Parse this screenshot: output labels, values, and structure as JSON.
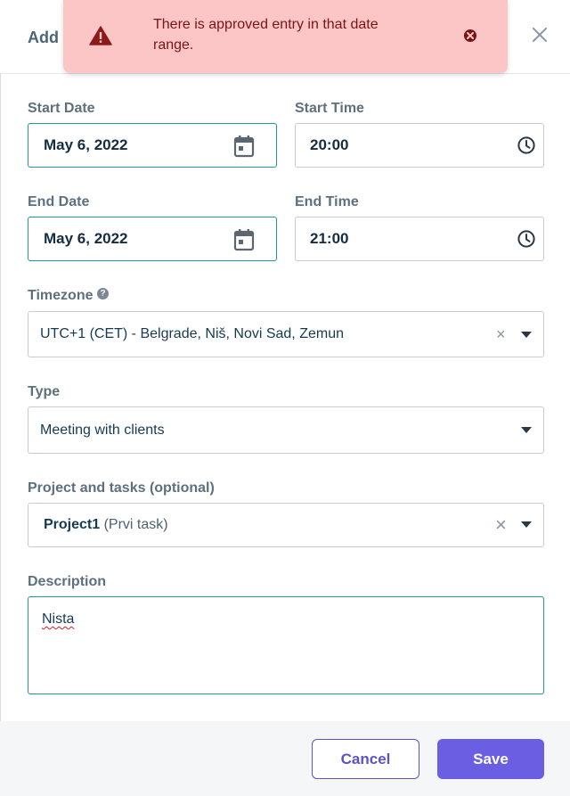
{
  "modal": {
    "title": "Add",
    "close_icon": "close-icon"
  },
  "toast": {
    "message": "There is approved entry in that date range.",
    "background": "#fdc6c6",
    "text_color": "#7a1414",
    "icons": [
      "warning-icon",
      "close-circle-icon"
    ]
  },
  "form": {
    "start_date": {
      "label": "Start Date",
      "value": "May 6, 2022",
      "icon": "calendar-icon"
    },
    "start_time": {
      "label": "Start Time",
      "value": "20:00",
      "icon": "clock-icon"
    },
    "end_date": {
      "label": "End Date",
      "value": "May 6, 2022",
      "icon": "calendar-icon"
    },
    "end_time": {
      "label": "End Time",
      "value": "21:00",
      "icon": "clock-icon"
    },
    "timezone": {
      "label": "Timezone",
      "value": "UTC+1 (CET) - Belgrade, Niš, Novi Sad, Zemun",
      "help_icon": "question-icon"
    },
    "type": {
      "label": "Type",
      "value": "Meeting with clients"
    },
    "project": {
      "label": "Project and tasks (optional)",
      "value": "Project1",
      "task": "(Prvi task)"
    },
    "description": {
      "label": "Description",
      "value": "Nista"
    }
  },
  "footer": {
    "cancel_label": "Cancel",
    "save_label": "Save"
  },
  "colors": {
    "accent": "#6a5ee3",
    "focus_border": "#1f9b91",
    "label": "#5e6f7e"
  }
}
